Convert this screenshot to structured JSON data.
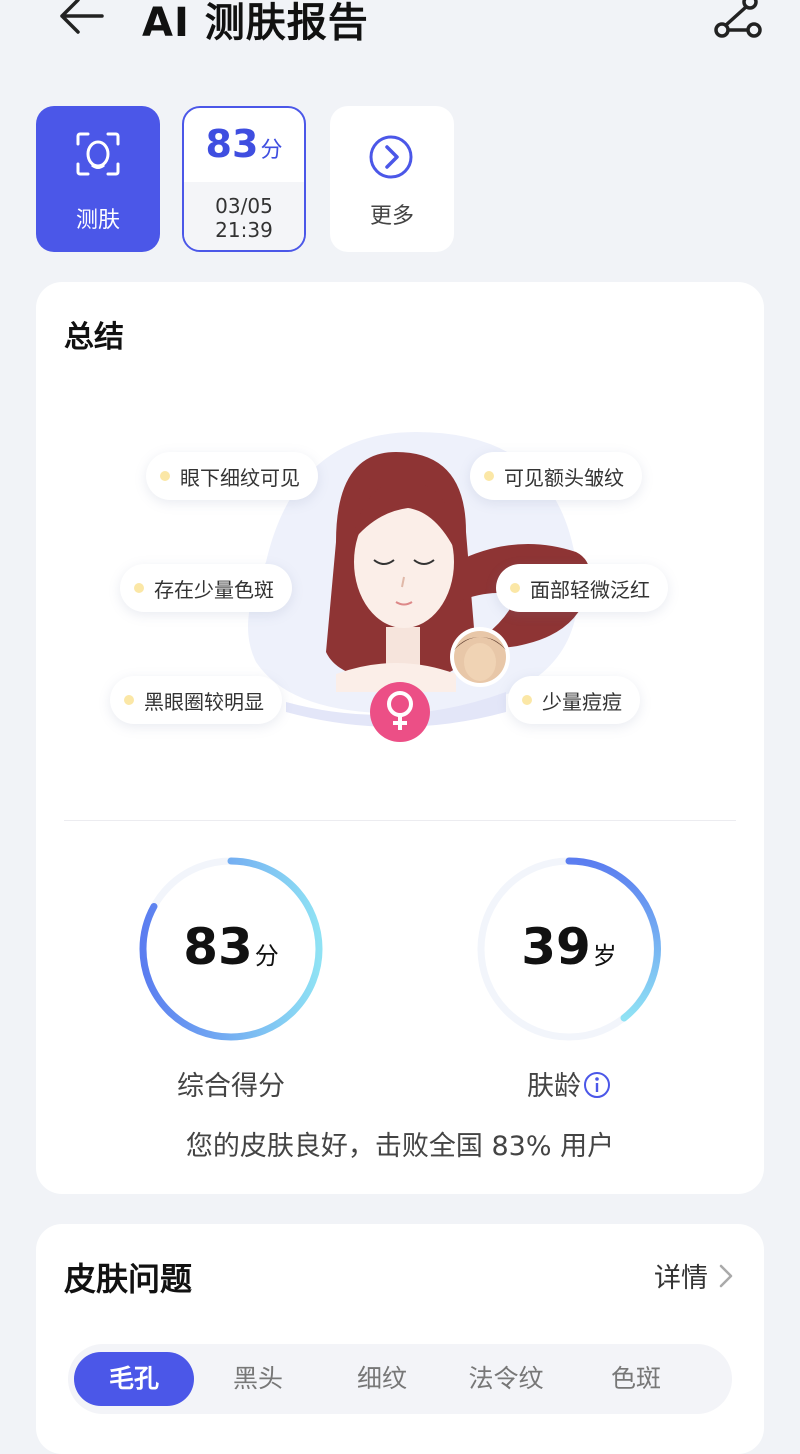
{
  "header": {
    "title": "AI 测肤报告"
  },
  "chips": {
    "scan": {
      "label": "测肤"
    },
    "record": {
      "score": "83",
      "score_unit": "分",
      "date": "03/05",
      "time": "21:39"
    },
    "more": {
      "label": "更多"
    }
  },
  "summary": {
    "title": "总结",
    "tags": [
      "眼下细纹可见",
      "可见额头皱纹",
      "存在少量色斑",
      "面部轻微泛红",
      "黑眼圈较明显",
      "少量痘痘"
    ],
    "score": {
      "value": "83",
      "unit": "分",
      "label": "综合得分",
      "fraction": 0.83
    },
    "skin_age": {
      "value": "39",
      "unit": "岁",
      "label": "肤龄"
    },
    "result_text": "您的皮肤良好，击败全国 83% 用户"
  },
  "issues": {
    "title": "皮肤问题",
    "details_label": "详情",
    "tabs": [
      "毛孔",
      "黑头",
      "细纹",
      "法令纹",
      "色斑"
    ],
    "active_tab": 0
  },
  "colors": {
    "accent": "#4b57e8",
    "female_badge": "#ec4f86",
    "hair": "#8e3434"
  }
}
